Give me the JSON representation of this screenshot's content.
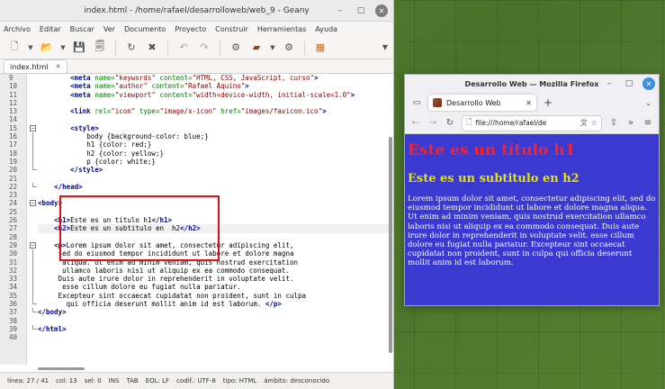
{
  "geany": {
    "title": "index.html - /home/rafael/desarrolloweb/web_9 - Geany",
    "menu": [
      "Archivo",
      "Editar",
      "Buscar",
      "Ver",
      "Documento",
      "Proyecto",
      "Construir",
      "Herramientas",
      "Ayuda"
    ],
    "tab_name": "index.html",
    "code_lines": [
      {
        "n": "9",
        "html": "        <span class='tag'>&lt;meta</span> <span class='attr'>name=</span><span class='str'>\"keywords\"</span> <span class='attr'>content=</span><span class='str'>\"HTML, CSS, JavaScript, curso\"</span><span class='tag'>&gt;</span>"
      },
      {
        "n": "10",
        "html": "        <span class='tag'>&lt;meta</span> <span class='attr'>name=</span><span class='str'>\"author\"</span> <span class='attr'>content=</span><span class='str'>\"Rafael Aquino\"</span><span class='tag'>&gt;</span>"
      },
      {
        "n": "11",
        "html": "        <span class='tag'>&lt;meta</span> <span class='attr'>name=</span><span class='str'>\"viewport\"</span> <span class='attr'>content=</span><span class='str'>\"width=device-width, initial-scale=1.0\"</span><span class='tag'>&gt;</span>"
      },
      {
        "n": "12",
        "html": ""
      },
      {
        "n": "13",
        "html": "        <span class='tag'>&lt;link</span> <span class='attr'>rel=</span><span class='str'>\"icon\"</span> <span class='attr'>type=</span><span class='str'>\"image/x-icon\"</span> <span class='attr'>href=</span><span class='str'>\"images/favicon.ico\"</span><span class='tag'>&gt;</span>"
      },
      {
        "n": "14",
        "html": ""
      },
      {
        "n": "15",
        "html": "        <span class='tag'>&lt;style&gt;</span>"
      },
      {
        "n": "16",
        "html": "            <span class='txt'>body {background-color: blue;}</span>"
      },
      {
        "n": "17",
        "html": "            <span class='txt'>h1 {color: red;}</span>"
      },
      {
        "n": "18",
        "html": "            <span class='txt'>h2 {color: yellow;}</span>"
      },
      {
        "n": "19",
        "html": "            <span class='txt'>p {color: white;}</span>"
      },
      {
        "n": "20",
        "html": "        <span class='tag'>&lt;/style&gt;</span>"
      },
      {
        "n": "21",
        "html": ""
      },
      {
        "n": "22",
        "html": "    <span class='tag'>&lt;/head&gt;</span>"
      },
      {
        "n": "23",
        "html": ""
      },
      {
        "n": "24",
        "html": "<span class='tag'>&lt;body&gt;</span>"
      },
      {
        "n": "25",
        "html": ""
      },
      {
        "n": "26",
        "html": "    <span class='tag'>&lt;h1&gt;</span><span class='txt'>Este es un título h1</span><span class='tag'>&lt;/h1&gt;</span>"
      },
      {
        "n": "27",
        "html": "    <span class='tag'>&lt;h2&gt;</span><span class='txt'>Este es un subtitulo en  h2</span><span class='tag'>&lt;/h2&gt;</span>"
      },
      {
        "n": "28",
        "html": ""
      },
      {
        "n": "29",
        "html": "    <span class='tag'>&lt;p&gt;</span><span class='txt'>Lorem ipsum dolor sit amet, consectetur adipiscing elit,</span>"
      },
      {
        "n": "30",
        "html": "<span class='txt'>     sed do eiusmod tempor incididunt ut labore et dolore magna</span>"
      },
      {
        "n": "31",
        "html": "<span class='txt'>      aliqua. Ut enim ad minim veniam, quis nostrud exercitation</span>"
      },
      {
        "n": "32",
        "html": "<span class='txt'>      ullamco laboris nisi ut aliquip ex ea commodo consequat.</span>"
      },
      {
        "n": "33",
        "html": "<span class='txt'>     Duis aute irure dolor in reprehenderit in voluptate velit.</span>"
      },
      {
        "n": "34",
        "html": "<span class='txt'>      esse cillum dolore eu fugiat nulla pariatur.</span>"
      },
      {
        "n": "35",
        "html": "<span class='txt'>     Excepteur sint occaecat cupidatat non proident, sunt in culpa</span>"
      },
      {
        "n": "36",
        "html": "<span class='txt'>       qui officia deserunt mollit anim id est laborum. </span><span class='tag'>&lt;/p&gt;</span>"
      },
      {
        "n": "37",
        "html": "<span class='tag'>&lt;/body&gt;</span>"
      },
      {
        "n": "38",
        "html": ""
      },
      {
        "n": "39",
        "html": "<span class='tag'>&lt;/html&gt;</span>"
      },
      {
        "n": "40",
        "html": ""
      }
    ],
    "status": [
      "línea: 27 / 41",
      "col: 13",
      "sel: 0",
      "INS",
      "TAB",
      "EOL: LF",
      "codif.: UTF-8",
      "tipo: HTML",
      "ámbito: desconocido"
    ]
  },
  "firefox": {
    "title": "Desarrollo Web — Mozilla Firefox",
    "tab_label": "Desarrollo Web",
    "url": "file:///home/rafael/de",
    "page": {
      "h1": "Este es un título h1",
      "h2": "Este es un subtitulo en h2",
      "p": "Lorem ipsum dolor sit amet, consectetur adipiscing elit, sed do eiusmod tempor incididunt ut labore et dolore magna aliqua. Ut enim ad minim veniam, quis nostrud exercitation ullamco laboris nisi ut aliquip ex ea commodo consequat. Duis aute irure dolor in reprehenderit in voluptate velit. esse cillum dolore eu fugiat nulla pariatur. Excepteur sint occaecat cupidatat non proident, sunt in culpa qui officia deserunt mollit anim id est laborum."
    }
  },
  "colors": {
    "highlight_box": "#e0101b",
    "page_background": "#3a3ad0",
    "h1": "#ff2020",
    "h2": "#e4e400",
    "p": "#ffffff"
  }
}
